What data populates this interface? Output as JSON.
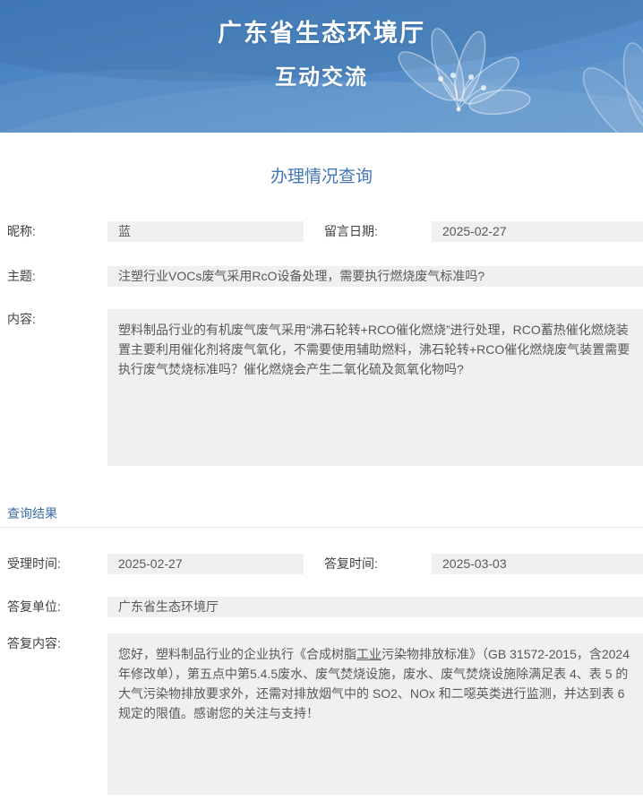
{
  "banner": {
    "title_line1": "广东省生态环境厅",
    "title_line2": "互动交流"
  },
  "page": {
    "section_title": "办理情况查询",
    "result_section_title": "查询结果"
  },
  "query": {
    "nickname_label": "昵称:",
    "nickname_value": "蓝",
    "message_date_label": "留言日期:",
    "message_date_value": "2025-02-27",
    "subject_label": "主题:",
    "subject_value": "注塑行业VOCs废气采用RcO设备处理，需要执行燃烧废气标准吗?",
    "content_label": "内容:",
    "content_value": "塑料制品行业的有机废气废气采用“沸石轮转+RCO催化燃烧”进行处理，RCO蓄热催化燃烧装置主要利用催化剂将废气氧化，不需要使用辅助燃料，沸石轮转+RCO催化燃烧废气装置需要执行废气焚烧标准吗？催化燃烧会产生二氧化硫及氮氧化物吗?"
  },
  "result": {
    "accept_time_label": "受理时间:",
    "accept_time_value": "2025-02-27",
    "reply_time_label": "答复时间:",
    "reply_time_value": "2025-03-03",
    "reply_unit_label": "答复单位:",
    "reply_unit_value": "广东省生态环境厅",
    "reply_content_label": "答复内容:",
    "reply_content_part1": "您好，塑料制品行业的企业执行《合成树脂",
    "reply_content_underlined": "工业",
    "reply_content_part2": "污染物排放标准》（GB 31572-2015，含2024年修改单），第五点中第5.4.5废水、废气焚烧设施，废水、废气焚烧设施除满足表 4、表 5 的大气污染物排放要求外，还需对排放烟气中的 SO2、NOx 和二噁英类进行监测，并达到表 6 规定的限值。感谢您的关注与支持！"
  },
  "colors": {
    "banner_blue_top": "#447fbc",
    "banner_blue_bottom": "#6097ce",
    "page_title_blue": "#4377b8",
    "result_title_blue": "#3a6ea5",
    "field_background": "#f0f0f0"
  }
}
